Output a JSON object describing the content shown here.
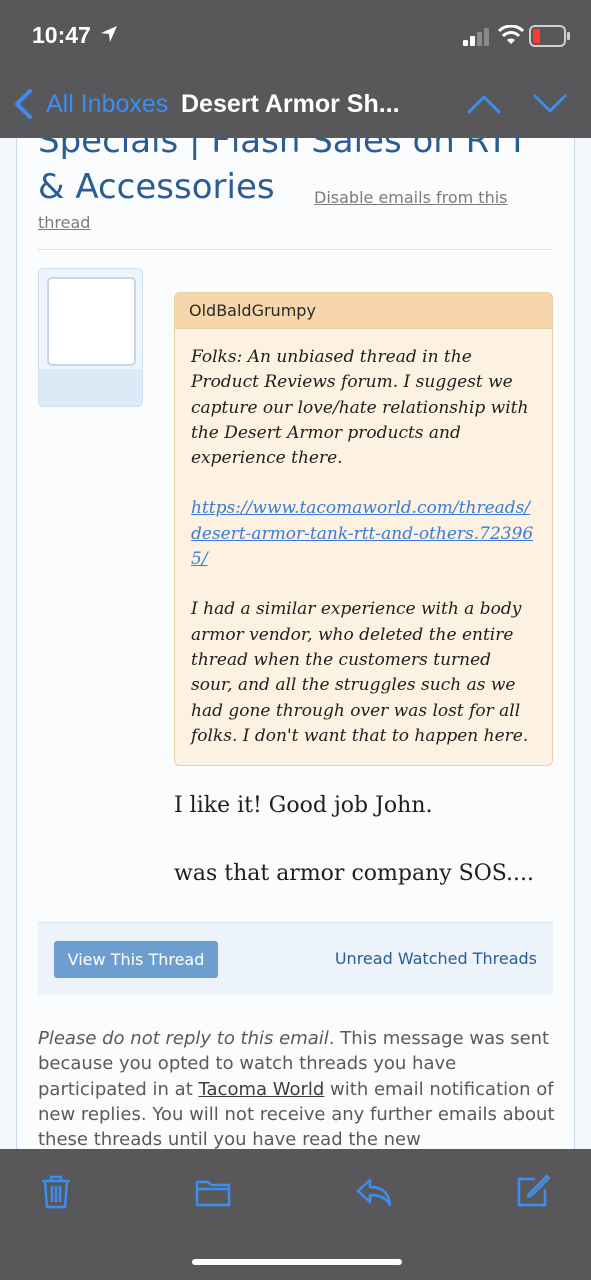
{
  "status_bar": {
    "time": "10:47"
  },
  "nav": {
    "back_label": "All Inboxes",
    "title": "Desert Armor Sh...",
    "accent_color": "#3c8df2"
  },
  "email": {
    "subject_line1": "Specials | Flash Sales on RTT",
    "subject_line2": "& Accessories",
    "disable_link_part1": "Disable emails from this",
    "disable_link_part2": "thread",
    "quote": {
      "author": "OldBaldGrumpy",
      "para1": "Folks: An unbiased thread in the Product Reviews forum. I suggest we capture our love/hate relationship with the Desert Armor products and experience there.",
      "link": "https://www.tacomaworld.com/threads/desert-armor-tank-rtt-and-others.723965/",
      "para2": "I had a similar experience with a body armor vendor, who deleted the entire thread when the customers turned sour, and all the struggles such as we had gone through over was lost for all folks. I don't want that to happen here."
    },
    "reply_line1": "I like it! Good job John.",
    "reply_line2": "was that armor company SOS....",
    "view_thread_button": "View This Thread",
    "unread_link": "Unread Watched Threads",
    "footer": {
      "italic": "Please do not reply to this email",
      "text1": ". This message was sent because you opted to watch threads you have participated in at ",
      "site": "Tacoma World",
      "text2": " with email notification of new replies. You will not receive any further emails about these threads until you have read the new"
    }
  },
  "toolbar": {
    "icons": [
      "trash-icon",
      "folder-icon",
      "reply-icon",
      "compose-icon"
    ]
  }
}
